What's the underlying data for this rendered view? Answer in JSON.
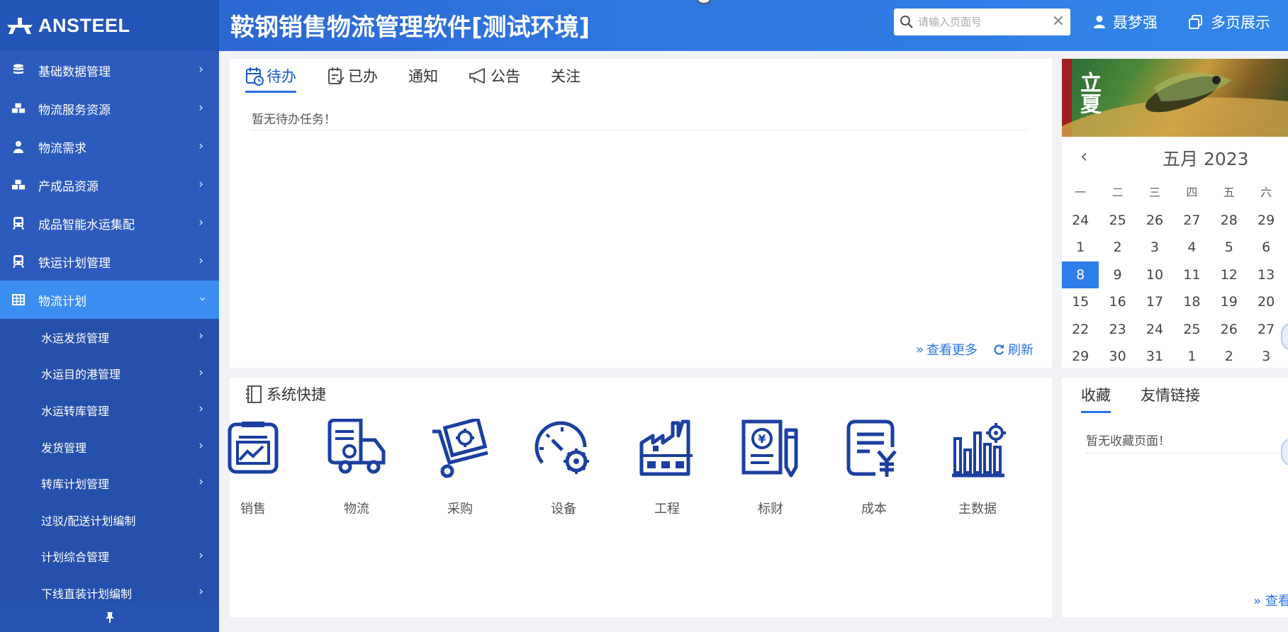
{
  "header": {
    "logo_text": "ANSTEEL",
    "title": "鞍钢销售物流管理软件[测试环境]",
    "search_placeholder": "请输入页面号",
    "user_name": "聂梦强",
    "multi_page": "多页展示"
  },
  "sidebar": {
    "items": [
      {
        "label": "基础数据管理",
        "icon": "database-icon"
      },
      {
        "label": "物流服务资源",
        "icon": "cubes-icon"
      },
      {
        "label": "物流需求",
        "icon": "user-icon"
      },
      {
        "label": "产成品资源",
        "icon": "cubes-icon"
      },
      {
        "label": "成品智能水运集配",
        "icon": "train-icon"
      },
      {
        "label": "铁运计划管理",
        "icon": "train-icon"
      },
      {
        "label": "物流计划",
        "icon": "table-icon"
      }
    ],
    "subitems": [
      {
        "label": "水运发货管理"
      },
      {
        "label": "水运目的港管理"
      },
      {
        "label": "水运转库管理"
      },
      {
        "label": "发货管理"
      },
      {
        "label": "转库计划管理"
      },
      {
        "label": "过驳/配送计划编制"
      },
      {
        "label": "计划综合管理"
      },
      {
        "label": "下线直装计划编制"
      }
    ]
  },
  "todo": {
    "tabs": [
      "待办",
      "已办",
      "通知",
      "公告",
      "关注"
    ],
    "empty_text": "暂无待办任务！",
    "more": "查看更多",
    "refresh": "刷新"
  },
  "calendar": {
    "image_text": "立夏",
    "title": "五月 2023",
    "weekdays": [
      "一",
      "二",
      "三",
      "四",
      "五",
      "六"
    ],
    "weeks": [
      [
        "24",
        "25",
        "26",
        "27",
        "28",
        "29"
      ],
      [
        "1",
        "2",
        "3",
        "4",
        "5",
        "6"
      ],
      [
        "8",
        "9",
        "10",
        "11",
        "12",
        "13"
      ],
      [
        "15",
        "16",
        "17",
        "18",
        "19",
        "20"
      ],
      [
        "22",
        "23",
        "24",
        "25",
        "26",
        "27"
      ],
      [
        "29",
        "30",
        "31",
        "1",
        "2",
        "3"
      ]
    ],
    "selected": "8"
  },
  "system": {
    "title": "系统快捷",
    "shortcuts": [
      {
        "label": "销售",
        "icon": "sales-chart-icon"
      },
      {
        "label": "物流",
        "icon": "logistics-truck-icon"
      },
      {
        "label": "采购",
        "icon": "purchase-cart-icon"
      },
      {
        "label": "设备",
        "icon": "equipment-gauge-icon"
      },
      {
        "label": "工程",
        "icon": "engineering-factory-icon"
      },
      {
        "label": "标财",
        "icon": "finance-document-icon"
      },
      {
        "label": "成本",
        "icon": "cost-yen-icon"
      },
      {
        "label": "主数据",
        "icon": "master-data-icon"
      }
    ]
  },
  "favorites": {
    "tabs": [
      "收藏",
      "友情链接"
    ],
    "empty_text": "暂无收藏页面！",
    "more": "» 查看"
  },
  "colors": {
    "header_blue": "#2e73de",
    "sidebar_blue": "#2c5bbd",
    "active_blue": "#3c8ef0",
    "icon_navy": "#1b3fa0",
    "link_blue": "#2d74e0"
  }
}
